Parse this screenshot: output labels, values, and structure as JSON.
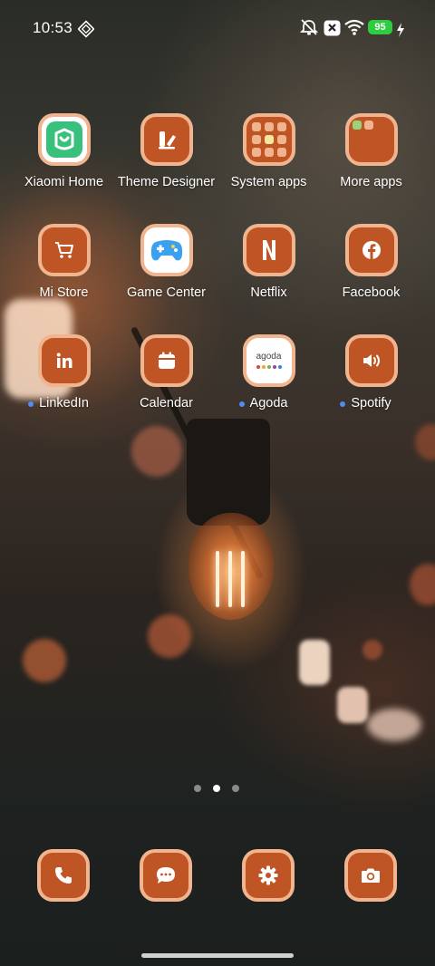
{
  "status_bar": {
    "time": "10:53",
    "battery_level": "95",
    "icons": [
      "cast-icon",
      "mute-icon",
      "close-box-icon",
      "wifi-icon",
      "battery-icon",
      "charging-bolt-icon"
    ],
    "battery_color": "#2ecc40"
  },
  "theme": {
    "icon_fill": "#bf5424",
    "icon_border": "#f0b58f",
    "notification_dot": "#4f8df5"
  },
  "apps": [
    {
      "label": "Xiaomi Home",
      "icon": "xiaomi-home-icon",
      "badge": false
    },
    {
      "label": "Theme Designer",
      "icon": "theme-designer-icon",
      "badge": false
    },
    {
      "label": "System apps",
      "icon": "folder-system-apps-icon",
      "badge": false
    },
    {
      "label": "More apps",
      "icon": "folder-more-apps-icon",
      "badge": false
    },
    {
      "label": "Mi Store",
      "icon": "shopping-cart-icon",
      "badge": false
    },
    {
      "label": "Game Center",
      "icon": "gamepad-icon",
      "badge": false
    },
    {
      "label": "Netflix",
      "icon": "netflix-icon",
      "badge": false
    },
    {
      "label": "Facebook",
      "icon": "facebook-icon",
      "badge": false
    },
    {
      "label": "LinkedIn",
      "icon": "linkedin-icon",
      "badge": true
    },
    {
      "label": "Calendar",
      "icon": "calendar-icon",
      "badge": false
    },
    {
      "label": "Agoda",
      "icon": "agoda-icon",
      "badge": true,
      "logo_text": "agoda"
    },
    {
      "label": "Spotify",
      "icon": "speaker-icon",
      "badge": true
    }
  ],
  "pager": {
    "pages": 3,
    "current_index": 1
  },
  "dock": [
    {
      "icon": "phone-icon"
    },
    {
      "icon": "messages-icon"
    },
    {
      "icon": "settings-gear-icon"
    },
    {
      "icon": "camera-icon"
    }
  ]
}
